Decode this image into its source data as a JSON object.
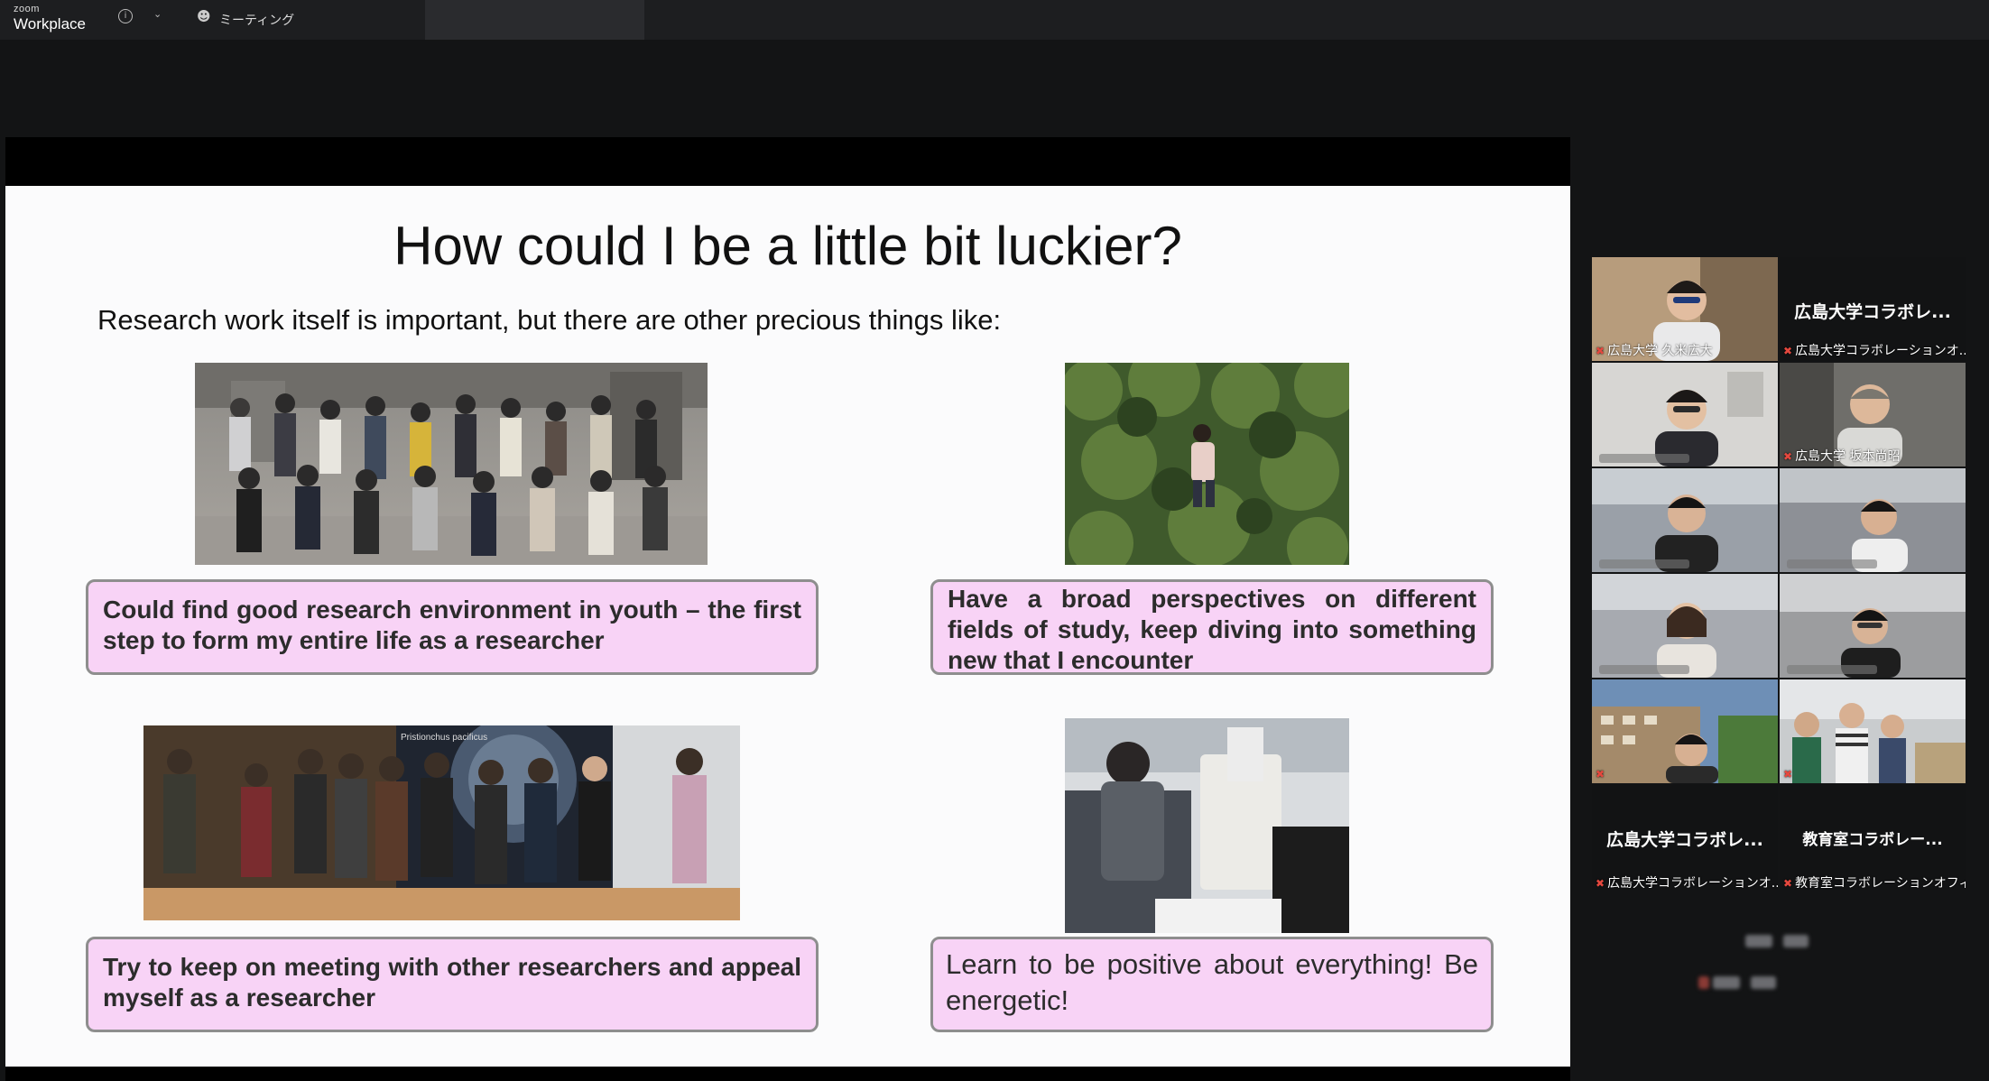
{
  "topbar": {
    "brand_small": "zoom",
    "brand_big": "Workplace",
    "meeting_label": "ミーティング"
  },
  "slide": {
    "title": "How could I be a little bit luckier?",
    "subtitle": "Research work itself is important, but there are other precious things like:",
    "captions": [
      "Could find good research environment in youth – the first step to form my entire life as a researcher",
      "Have a broad perspectives on different fields of study, keep diving into something new that I encounter",
      "Try to keep on meeting with other researchers and appeal myself as a researcher",
      "Learn to be positive about everything! Be energetic!"
    ],
    "photo_text": "Pristionchus pacificus",
    "caption_color": "#f8d3f6"
  },
  "gallery": {
    "participants": [
      {
        "name": "広島大学 久米広大"
      },
      {
        "name": "広島大学コラボレ...",
        "sub": "広島大学コラボレーションオ..."
      },
      {
        "name": ""
      },
      {
        "name": "広島大学 坂本尚昭"
      },
      {
        "name": ""
      },
      {
        "name": ""
      },
      {
        "name": ""
      },
      {
        "name": ""
      },
      {
        "name": ""
      },
      {
        "name": ""
      },
      {
        "name": "広島大学コラボレ...",
        "sub": "広島大学コラボレーションオ..."
      },
      {
        "name": "教育室コラボレー...",
        "sub": "教育室コラボレーションオフィ..."
      }
    ],
    "active_color": "#4fd57a"
  }
}
